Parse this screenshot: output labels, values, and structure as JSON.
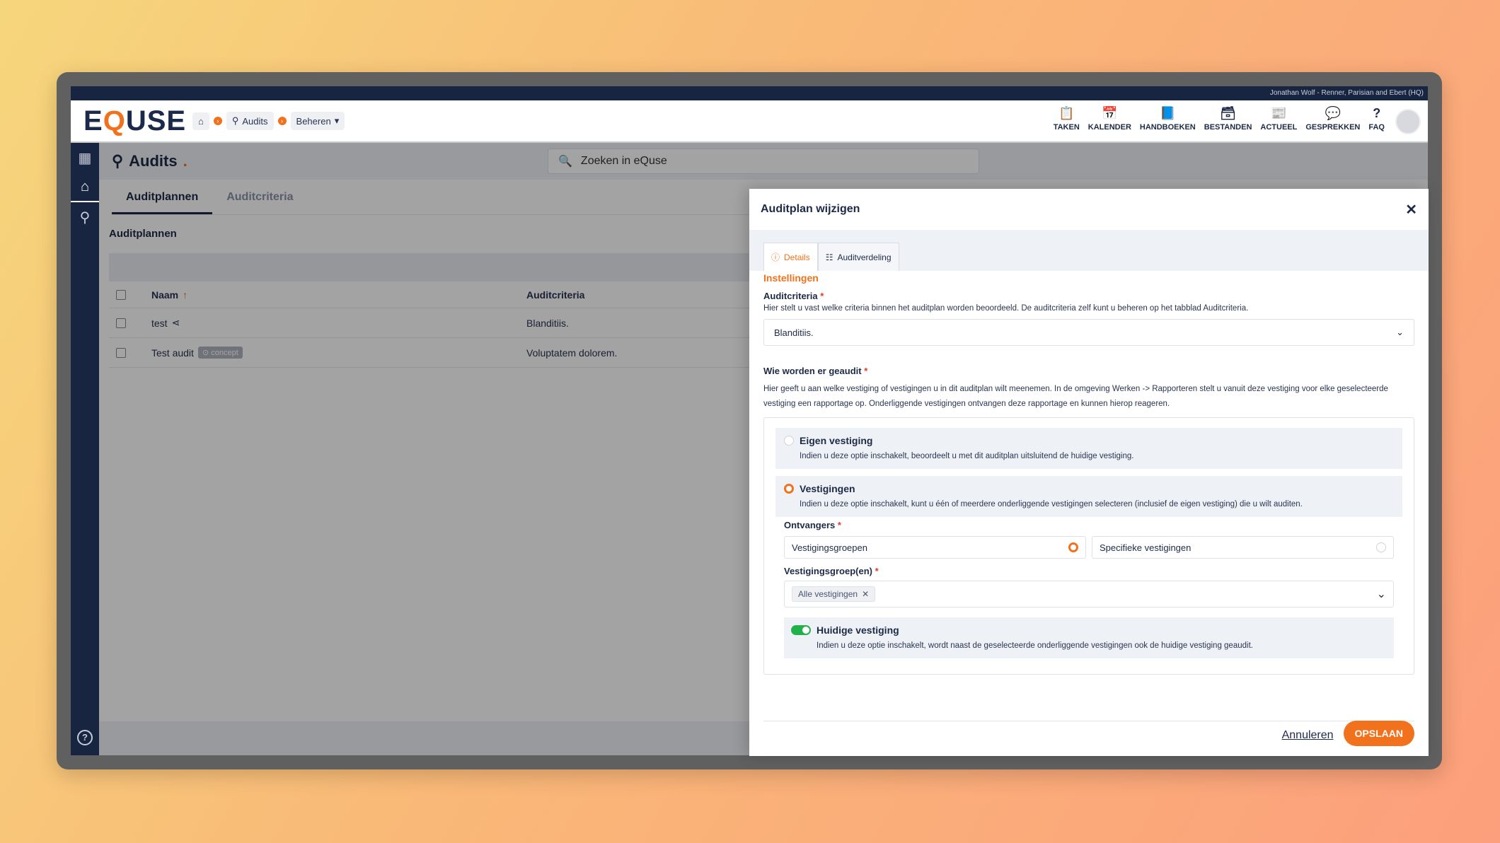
{
  "user_bar": {
    "text": "Jonathan Wolf - Renner, Parisian and Ebert (HQ)"
  },
  "logo": {
    "pre": "E",
    "q": "Q",
    "post": "USE"
  },
  "breadcrumb": {
    "audits": "Audits",
    "beheren": "Beheren"
  },
  "topnav": [
    {
      "label": "TAKEN",
      "icon": "clipboard-icon"
    },
    {
      "label": "KALENDER",
      "icon": "calendar-icon"
    },
    {
      "label": "HANDBOEKEN",
      "icon": "book-icon"
    },
    {
      "label": "BESTANDEN",
      "icon": "archive-icon"
    },
    {
      "label": "ACTUEEL",
      "icon": "news-icon"
    },
    {
      "label": "GESPREKKEN",
      "icon": "chat-icon"
    },
    {
      "label": "FAQ",
      "icon": "question-icon"
    }
  ],
  "page": {
    "title": "Audits",
    "title_dot": ".",
    "search_placeholder": "Zoeken in eQuse"
  },
  "tabs": {
    "auditplannen": "Auditplannen",
    "auditcriteria": "Auditcriteria"
  },
  "subhead": "Auditplannen",
  "table": {
    "headers": {
      "naam": "Naam",
      "auditcriteria": "Auditcriteria"
    },
    "rows": [
      {
        "naam": "test",
        "criteria": "Blanditiis."
      },
      {
        "naam": "Test audit",
        "badge": "concept",
        "criteria": "Voluptatem dolorem."
      }
    ]
  },
  "modal": {
    "title": "Auditplan wijzigen",
    "tab_details": "Details",
    "tab_auditverdeling": "Auditverdeling",
    "section": "Instellingen",
    "auditcriteria_label": "Auditcriteria",
    "auditcriteria_desc": "Hier stelt u vast welke criteria binnen het auditplan worden beoordeeld. De auditcriteria zelf kunt u beheren op het tabblad Auditcriteria.",
    "auditcriteria_value": "Blanditiis.",
    "wie_label": "Wie worden er geaudit",
    "wie_desc": "Hier geeft u aan welke vestiging of vestigingen u in dit auditplan wilt meenemen. In de omgeving Werken -> Rapporteren stelt u vanuit deze vestiging voor elke geselecteerde vestiging een rapportage op. Onderliggende vestigingen ontvangen deze rapportage en kunnen hierop reageren.",
    "opt_eigen_title": "Eigen vestiging",
    "opt_eigen_desc": "Indien u deze optie inschakelt, beoordeelt u met dit auditplan uitsluitend de huidige vestiging.",
    "opt_vest_title": "Vestigingen",
    "opt_vest_desc": "Indien u deze optie inschakelt, kunt u één of meerdere onderliggende vestigingen selecteren (inclusief de eigen vestiging) die u wilt auditen.",
    "ontvangers_label": "Ontvangers",
    "ontvangers_opt1": "Vestigingsgroepen",
    "ontvangers_opt2": "Specifieke vestigingen",
    "groepen_label": "Vestigingsgroep(en)",
    "groepen_chip": "Alle vestigingen",
    "huidige_title": "Huidige vestiging",
    "huidige_desc": "Indien u deze optie inschakelt, wordt naast de geselecteerde onderliggende vestigingen ook de huidige vestiging geaudit.",
    "cancel": "Annuleren",
    "save": "OPSLAAN"
  },
  "required_mark": "*",
  "colors": {
    "accent": "#f2711c",
    "navy": "#182541",
    "toggle_on": "#21b14b"
  }
}
